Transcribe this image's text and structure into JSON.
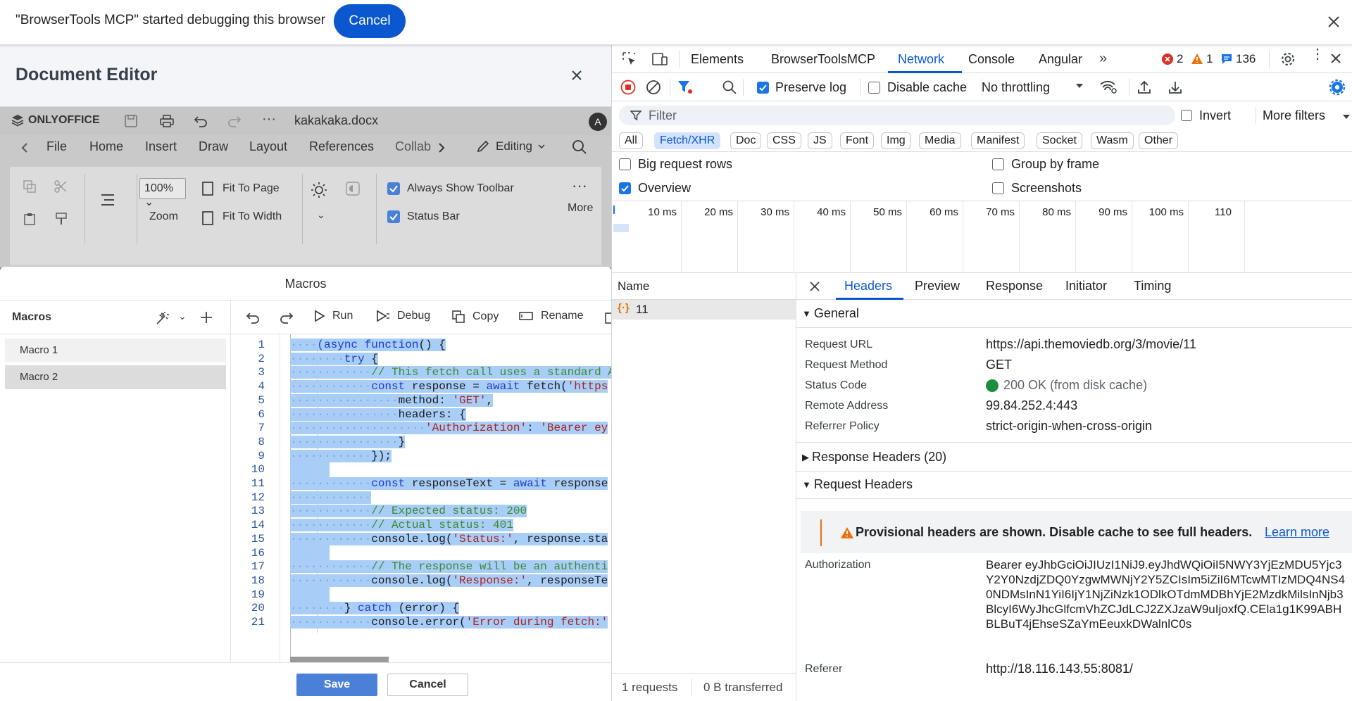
{
  "banner": {
    "message": "\"BrowserTools MCP\" started debugging this browser",
    "cancel_label": "Cancel"
  },
  "doc_editor": {
    "title": "Document Editor",
    "app": {
      "logo": "ONLYOFFICE",
      "filename": "kakakaka.docx",
      "avatar": "A",
      "menu": [
        "File",
        "Home",
        "Insert",
        "Draw",
        "Layout",
        "References",
        "Collab"
      ],
      "mode": "Editing",
      "zoom_value": "100%",
      "zoom_label": "Zoom",
      "fit_page": "Fit To Page",
      "fit_width": "Fit To Width",
      "always_show_toolbar": "Always Show Toolbar",
      "status_bar": "Status Bar",
      "more": "More"
    },
    "macros": {
      "title": "Macros",
      "sidebar_title": "Macros",
      "items": [
        {
          "label": "Macro 1"
        },
        {
          "label": "Macro 2"
        }
      ],
      "tools": {
        "run": "Run",
        "debug": "Debug",
        "copy": "Copy",
        "rename": "Rename"
      },
      "line_numbers": [
        "1",
        "2",
        "3",
        "4",
        "5",
        "6",
        "7",
        "8",
        "9",
        "10",
        "11",
        "12",
        "13",
        "14",
        "15",
        "16",
        "17",
        "18",
        "19",
        "20",
        "21"
      ],
      "save_label": "Save",
      "cancel_label": "Cancel"
    }
  },
  "devtools": {
    "tabs": [
      "Elements",
      "BrowserToolsMCP",
      "Network",
      "Console",
      "Angular"
    ],
    "active_tab": "Network",
    "errors": "2",
    "warnings": "1",
    "messages": "136",
    "toolbar": {
      "preserve_log": "Preserve log",
      "disable_cache": "Disable cache",
      "throttling": "No throttling"
    },
    "filter": {
      "placeholder": "Filter",
      "invert": "Invert",
      "more_filters": "More filters"
    },
    "type_filters": [
      "All",
      "Fetch/XHR",
      "Doc",
      "CSS",
      "JS",
      "Font",
      "Img",
      "Media",
      "Manifest",
      "Socket",
      "Wasm",
      "Other"
    ],
    "active_type": "Fetch/XHR",
    "options": {
      "big_request_rows": "Big request rows",
      "group_by_frame": "Group by frame",
      "overview": "Overview",
      "screenshots": "Screenshots"
    },
    "timeline_ticks": [
      "10 ms",
      "20 ms",
      "30 ms",
      "40 ms",
      "50 ms",
      "60 ms",
      "70 ms",
      "80 ms",
      "90 ms",
      "100 ms",
      "110"
    ],
    "requests": {
      "column": "Name",
      "rows": [
        {
          "name": "11"
        }
      ],
      "count": "1 requests",
      "transferred": "0 B transferred"
    },
    "detail": {
      "tabs": [
        "Headers",
        "Preview",
        "Response",
        "Initiator",
        "Timing"
      ],
      "active_tab": "Headers",
      "general_title": "General",
      "general": [
        {
          "key": "Request URL",
          "value": "https://api.themoviedb.org/3/movie/11"
        },
        {
          "key": "Request Method",
          "value": "GET"
        },
        {
          "key": "Status Code",
          "value": "200 OK (from disk cache)"
        },
        {
          "key": "Remote Address",
          "value": "99.84.252.4:443"
        },
        {
          "key": "Referrer Policy",
          "value": "strict-origin-when-cross-origin"
        }
      ],
      "response_headers_title": "Response Headers (20)",
      "request_headers_title": "Request Headers",
      "warning_text": "Provisional headers are shown. Disable cache to see full headers.",
      "learn_more": "Learn more",
      "auth_key": "Authorization",
      "auth_value": "Bearer eyJhbGciOiJIUzI1NiJ9.eyJhdWQiOiI5NWY3YjEzMDU5Yjc3Y2Y0NzdjZDQ0YzgwMWNjY2Y5ZCIsIm5iZiI6MTcwMTIzMDQ4NS40NDMsInN1YiI6IjY1NjZiNzk1ODlkOTdmMDBhYjE2MzdkMilsInNjb3BlcyI6WyJhcGlfcmVhZCJdLCJ2ZXJzaW9uIjoxfQ.CEla1g1K99ABHBLBuT4jEhseSZaYmEeuxkDWalnlC0s",
      "referer_key": "Referer",
      "referer_value": "http://18.116.143.55:8081/"
    }
  },
  "colors": {
    "accent_blue": "#0b57d0",
    "selection": "#a8cdf7",
    "status_green": "#1e8e3e",
    "error_red": "#d93025",
    "warning_orange": "#e8710a"
  }
}
